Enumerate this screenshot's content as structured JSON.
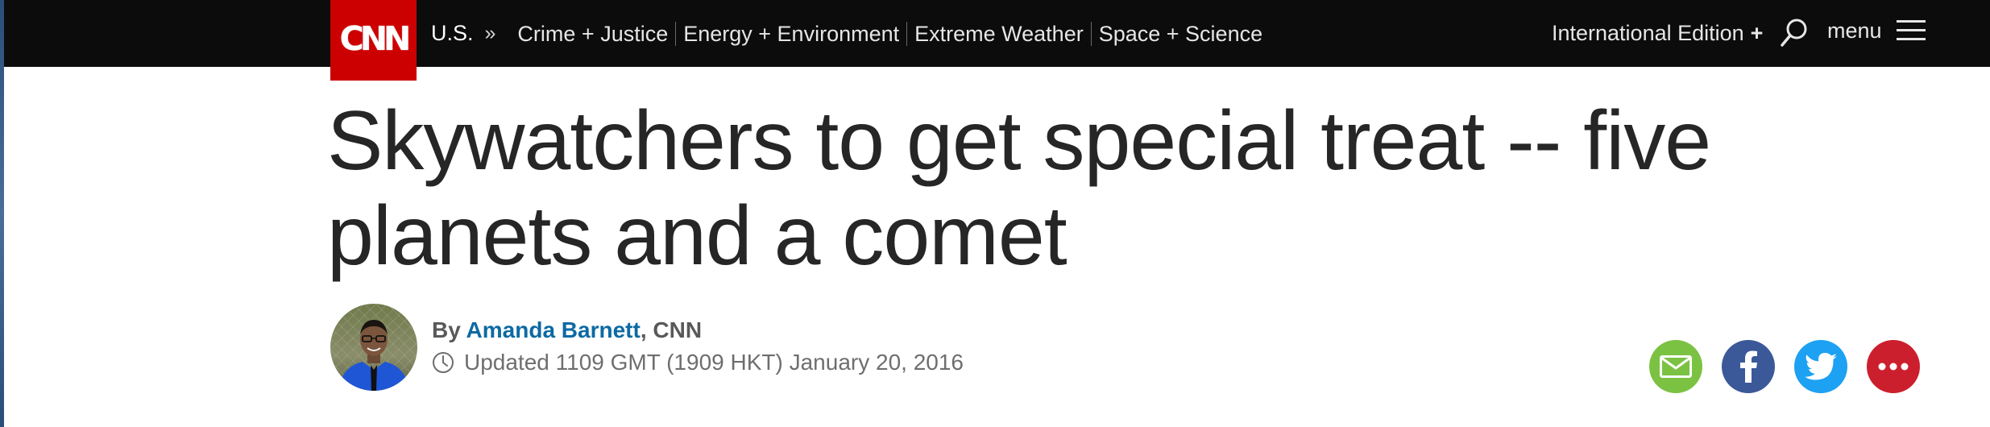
{
  "header": {
    "logo_text": "CNN",
    "section": "U.S.",
    "section_separator": "»",
    "nav_items": [
      "Crime + Justice",
      "Energy + Environment",
      "Extreme Weather",
      "Space + Science"
    ],
    "edition_label": "International Edition",
    "edition_plus": "+",
    "menu_label": "menu"
  },
  "article": {
    "headline": "Skywatchers to get special treat -- five planets and a comet",
    "byline_prefix": "By",
    "author": "Amanda Barnett",
    "byline_suffix": ", CNN",
    "updated": "Updated 1109 GMT (1909 HKT) January 20, 2016"
  },
  "share": {
    "buttons": [
      {
        "name": "email",
        "icon": "envelope-icon",
        "color": "#7bc243"
      },
      {
        "name": "facebook",
        "icon": "facebook-icon",
        "color": "#3b5998"
      },
      {
        "name": "twitter",
        "icon": "twitter-bird-icon",
        "color": "#1da1f2"
      },
      {
        "name": "more",
        "icon": "more-dots-icon",
        "color": "#cc1f2e"
      }
    ]
  },
  "colors": {
    "topbar": "#0c0c0c",
    "brand_red": "#cc0000",
    "author_link": "#0c6aa3",
    "headline": "#262626"
  }
}
